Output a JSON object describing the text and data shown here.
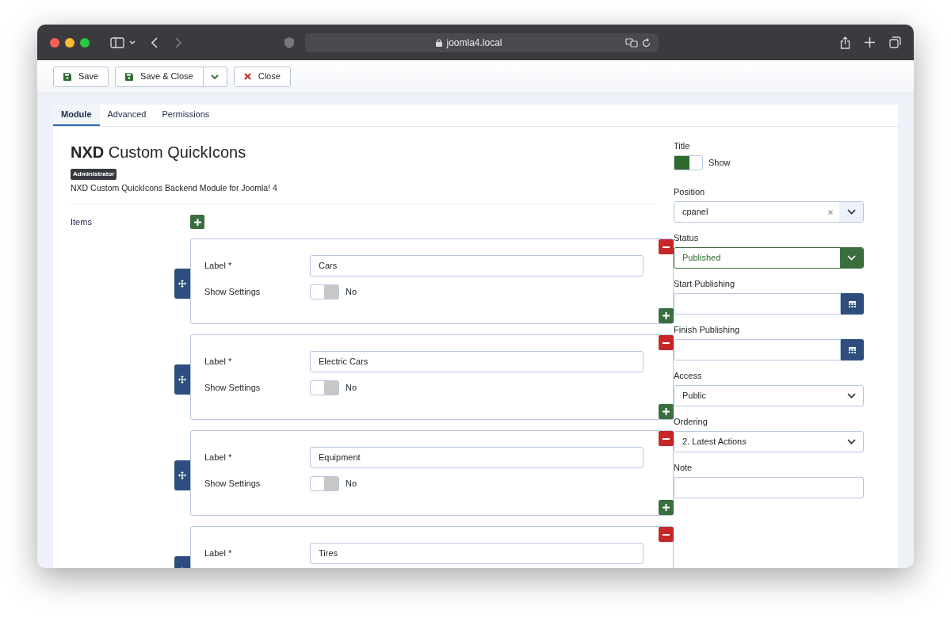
{
  "browser": {
    "url": "joomla4.local"
  },
  "toolbar": [
    {
      "kind": "save",
      "label": "Save",
      "dropdown": false
    },
    {
      "kind": "save",
      "label": "Save & Close",
      "dropdown": true
    },
    {
      "kind": "close",
      "label": "Close",
      "dropdown": false
    }
  ],
  "tabs": [
    {
      "label": "Module",
      "selected": true
    },
    {
      "label": "Advanced",
      "selected": false
    },
    {
      "label": "Permissions",
      "selected": false
    }
  ],
  "module": {
    "title": "**NXD** Custom QuickIcons",
    "badge": "Administrator",
    "description": "NXD Custom QuickIcons Backend Module for Joomla! 4"
  },
  "items_label": "Items",
  "items": [
    {
      "label_caption": "Label *",
      "value": "Cars",
      "settings_caption": "Show Settings",
      "show_settings": false,
      "settings_text": "No"
    },
    {
      "label_caption": "Label *",
      "value": "Electric Cars",
      "settings_caption": "Show Settings",
      "show_settings": false,
      "settings_text": "No"
    },
    {
      "label_caption": "Label *",
      "value": "Equipment",
      "settings_caption": "Show Settings",
      "show_settings": false,
      "settings_text": "No"
    },
    {
      "label_caption": "Label *",
      "value": "Tires"
    }
  ],
  "sidebar": [
    {
      "kind": "toggle",
      "label": "Title",
      "on": true,
      "text": "Show"
    },
    {
      "kind": "select",
      "label": "Position",
      "value": "cpanel",
      "clearable": true
    },
    {
      "kind": "status",
      "label": "Status",
      "value": "Published"
    },
    {
      "kind": "date",
      "label": "Start Publishing"
    },
    {
      "kind": "date",
      "label": "Finish Publishing"
    },
    {
      "kind": "select",
      "label": "Access",
      "value": "Public",
      "clearable": false
    },
    {
      "kind": "select",
      "label": "Ordering",
      "value": "2. Latest Actions",
      "clearable": false
    },
    {
      "kind": "text",
      "label": "Note"
    }
  ]
}
